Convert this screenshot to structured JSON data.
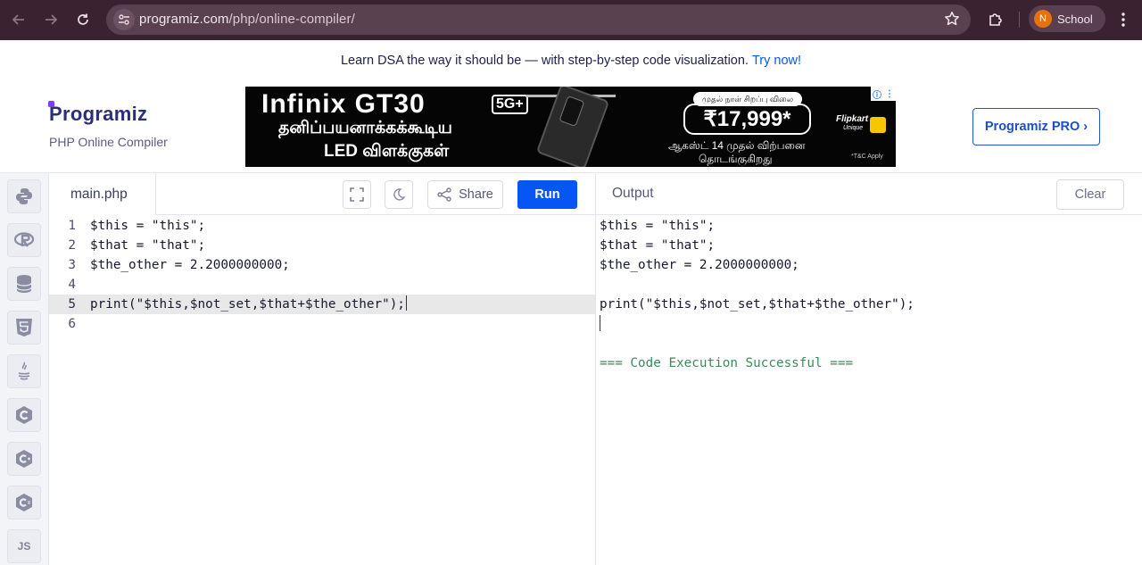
{
  "browser": {
    "url_host": "programiz.com",
    "url_path": "/php/online-compiler/",
    "profile_initial": "N",
    "profile_name": "School"
  },
  "announcement": {
    "text": "Learn DSA the way it should be — with step-by-step code visualization.",
    "link": "Try now!"
  },
  "brand": {
    "logo_text": "rogramiz",
    "logo_first": "P",
    "subtitle": "PHP Online Compiler"
  },
  "ad": {
    "line1": "Infinix GT30",
    "badge_5g": "5G+",
    "line2": "தனிப்பயனாக்கக்கூடிய",
    "line3": "LED விளக்குகள்",
    "offer_badge": "முதல் நாள் சிறப்பு விலை",
    "price": "₹17,999*",
    "sale_line1": "ஆகஸ்ட் 14 முதல் விற்பனை",
    "sale_line2": "தொடங்குகிறது",
    "brand": "Flipkart",
    "brand_sub": "Unique",
    "tnc": "*T&C Apply"
  },
  "header": {
    "pro_button": "Programiz PRO ›"
  },
  "languages": [
    "python-icon",
    "r-icon",
    "sql-icon",
    "html5-icon",
    "java-icon",
    "c-icon",
    "cpp-icon",
    "csharp-icon",
    "JS"
  ],
  "editor": {
    "filename": "main.php",
    "share_label": "Share",
    "run_label": "Run",
    "line_numbers": [
      "1",
      "2",
      "3",
      "4",
      "5",
      "6"
    ],
    "lines": [
      "$this = \"this\";",
      "$that = \"that\";",
      "$the_other = 2.2000000000;",
      "",
      "print(\"$this,$not_set,$that+$the_other\");",
      ""
    ]
  },
  "output": {
    "title": "Output",
    "clear_label": "Clear",
    "lines": [
      "$this = \"this\";",
      "$that = \"that\";",
      "$the_other = 2.2000000000;",
      "",
      "print(\"$this,$not_set,$that+$the_other\");"
    ],
    "status": "=== Code Execution Successful ==="
  },
  "colors": {
    "accent": "#0556f3",
    "chrome_bg": "#3b2230",
    "success": "#3c8a5a"
  }
}
